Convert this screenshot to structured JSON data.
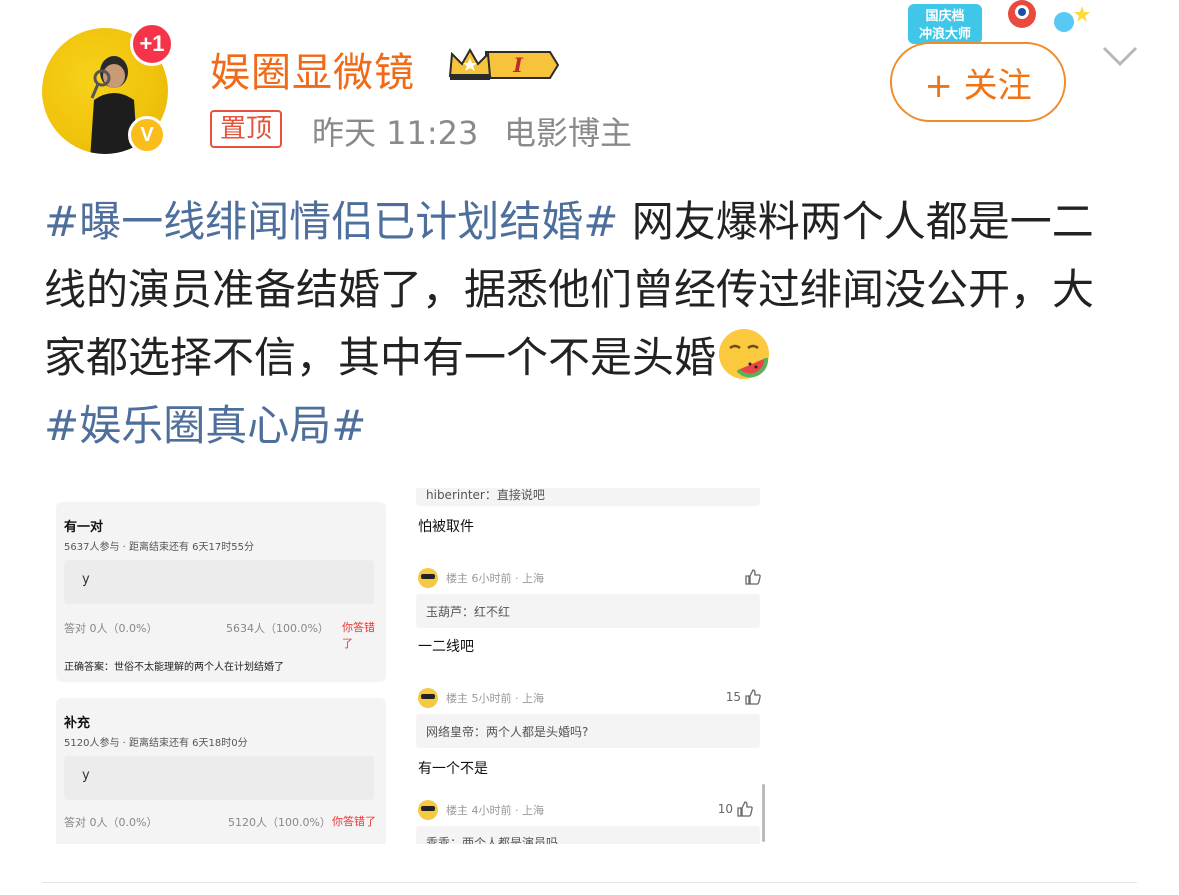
{
  "header": {
    "username": "娱圈显微镜",
    "rank_badge_text": "I",
    "avatar_notice": "+1",
    "verified_mark": "V",
    "pinned_label": "置顶",
    "time": "昨天 11:23",
    "role": "电影博主",
    "follow_label": "+ 关注",
    "promo_text_1": "国庆档",
    "promo_text_2": "冲浪大师"
  },
  "post": {
    "hashtag1": "#曝一线绯闻情侣已计划结婚#",
    "body": " 网友爆料两个人都是一二线的演员准备结婚了，据悉他们曾经传过绯闻没公开，大家都选择不信，其中有一个不是头婚",
    "hashtag2": "#娱乐圈真心局#"
  },
  "left_shot": {
    "card1": {
      "title": "有一对",
      "sub": "5637人参与 · 距离结束还有 6天17时55分",
      "option": "y",
      "stat_left": "答对  0人（0.0%）",
      "stat_mid": "5634人（100.0%）",
      "wrong": "你答错了",
      "answer": "正确答案：世俗不太能理解的两个人在计划结婚了"
    },
    "card2": {
      "title": "补充",
      "sub": "5120人参与 · 距离结束还有 6天18时0分",
      "option": "y",
      "stat_left": "答对  0人（0.0%）",
      "stat_mid": "5120人（100.0%）",
      "wrong": "你答错了"
    }
  },
  "right_shot": {
    "top_quote": "hiberinter：直接说吧",
    "reply1": "怕被取件",
    "meta1": {
      "text": "楼主  6小时前 · 上海",
      "likes": ""
    },
    "quote2": "玉葫芦：红不红",
    "reply2": "一二线吧",
    "meta2": {
      "text": "楼主  5小时前 · 上海",
      "likes": "15"
    },
    "quote3": "网络皇帝：两个人都是头婚吗?",
    "reply3": "有一个不是",
    "meta3": {
      "text": "楼主  4小时前 · 上海",
      "likes": "10"
    },
    "quote4": "乖乖：两个人都是演员吗"
  },
  "colors": {
    "username": "#f06a17",
    "hashtag": "#4e6f9b",
    "pinned": "#e5533c",
    "follow": "#f07314",
    "notice_badge": "#f5344a"
  }
}
